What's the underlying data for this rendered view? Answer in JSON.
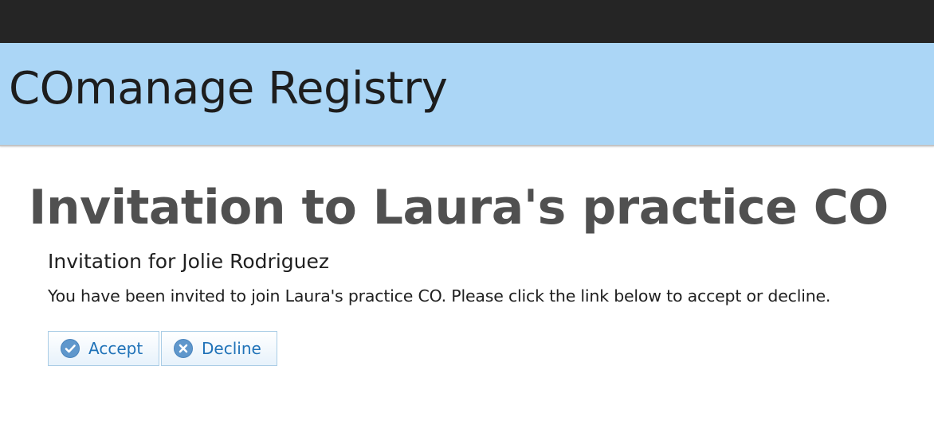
{
  "header": {
    "app_title": "COmanage Registry"
  },
  "main": {
    "page_title": "Invitation to Laura's practice CO",
    "subtitle": "Invitation for Jolie Rodriguez",
    "message": "You have been invited to join Laura's practice CO. Please click the link below to accept or decline."
  },
  "actions": {
    "accept_label": "Accept",
    "accept_icon": "check-circle-icon",
    "decline_label": "Decline",
    "decline_icon": "x-circle-icon"
  },
  "colors": {
    "top_bar": "#252525",
    "header_bg": "#abd6f6",
    "button_text": "#1f72b8",
    "icon_fill": "#5f97cc"
  }
}
